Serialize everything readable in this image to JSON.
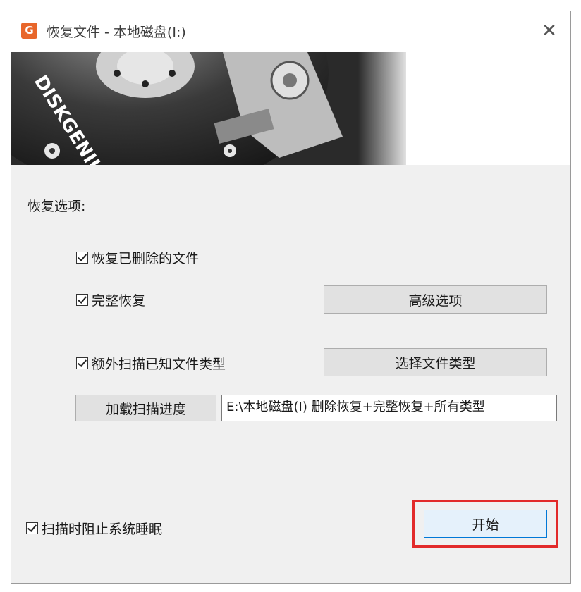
{
  "window": {
    "title": "恢复文件 - 本地磁盘(I:)",
    "app_icon": "G",
    "close_glyph": "✕"
  },
  "banner": {
    "brand_text": "DISKGENIUS"
  },
  "options": {
    "section_label": "恢复选项:",
    "recover_deleted": {
      "label": "恢复已删除的文件",
      "checked": true
    },
    "full_recover": {
      "label": "完整恢复",
      "checked": true
    },
    "advanced_button": "高级选项",
    "extra_scan": {
      "label": "额外扫描已知文件类型",
      "checked": true
    },
    "select_types_button": "选择文件类型",
    "load_progress_button": "加载扫描进度",
    "progress_path": "E:\\本地磁盘(I) 删除恢复+完整恢复+所有类型"
  },
  "footer": {
    "prevent_sleep": {
      "label": "扫描时阻止系统睡眠",
      "checked": true
    },
    "start_button": "开始"
  },
  "colors": {
    "highlight": "#e22a2a",
    "app_icon": "#e8662a"
  }
}
